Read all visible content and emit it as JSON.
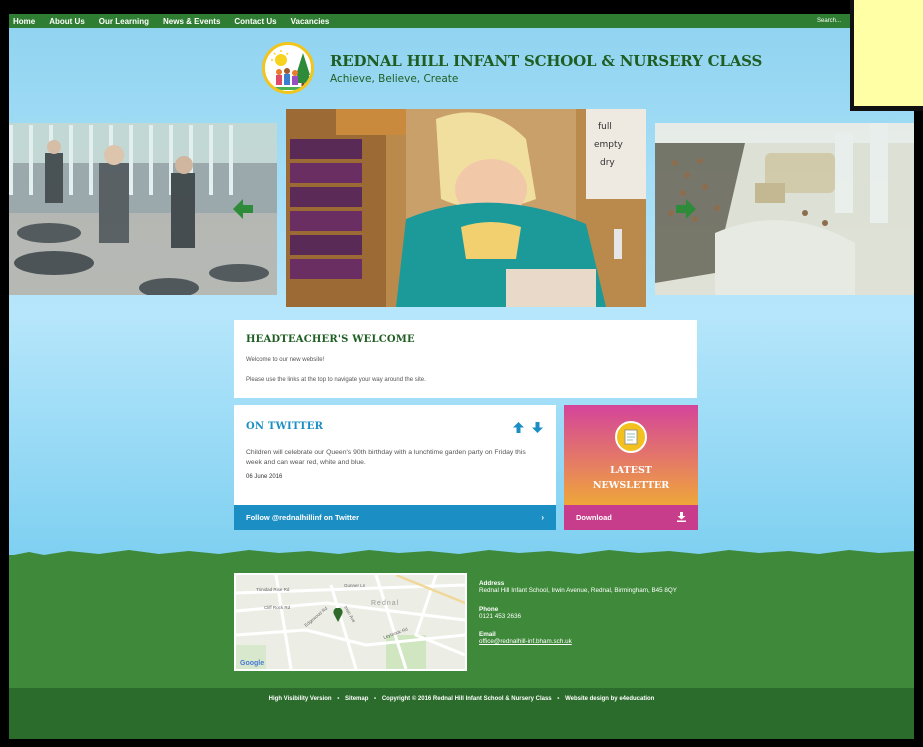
{
  "nav": {
    "items": [
      "Home",
      "About Us",
      "Our Learning",
      "News & Events",
      "Contact Us",
      "Vacancies"
    ],
    "search_label": "Search..."
  },
  "header": {
    "school_name": "REDNAL HILL INFANT SCHOOL & NURSERY CLASS",
    "motto": "Achieve, Believe, Create"
  },
  "welcome": {
    "title": "HEADTEACHER'S WELCOME",
    "line1": "Welcome to our new website!",
    "line2": "Please use the links at the top to navigate your way around the site."
  },
  "twitter": {
    "title": "ON TWITTER",
    "tweet": "Children will celebrate our Queen's 90th birthday with a lunchtime garden party on Friday this week and can wear red, white and blue.",
    "date": "06 June 2016",
    "follow_label": "Follow @rednalhillinf on Twitter"
  },
  "newsletter": {
    "title_line1": "LATEST",
    "title_line2": "NEWSLETTER",
    "download_label": "Download"
  },
  "contact": {
    "address_label": "Address",
    "address": "Rednal Hill Infant School, Irwin Avenue, Rednal, Birmingham, B45 8QY",
    "phone_label": "Phone",
    "phone": "0121 453 2636",
    "email_label": "Email",
    "email": "office@rednalhill-inf.bham.sch.uk"
  },
  "map": {
    "place_label": "Rednal",
    "roads": [
      "Trinidad Rise Rd",
      "Cliff Rock Rd",
      "Irwin Ave",
      "Leybrook Rd",
      "Gunner Ln",
      "Edgewood Rd"
    ],
    "provider": "Google"
  },
  "footer": {
    "high_vis": "High Visibility Version",
    "sitemap": "Sitemap",
    "copyright": "Copyright © 2016 Rednal Hill Infant School & Nursery Class",
    "design": "Website design by e4education"
  },
  "colors": {
    "nav_green": "#2f7d32",
    "title_green": "#1f5e22",
    "twitter_blue": "#1b8fc4",
    "newsletter_pink": "#c83d8b",
    "newsletter_yellow": "#f3c01e",
    "footer_green": "#3f8a3a"
  }
}
